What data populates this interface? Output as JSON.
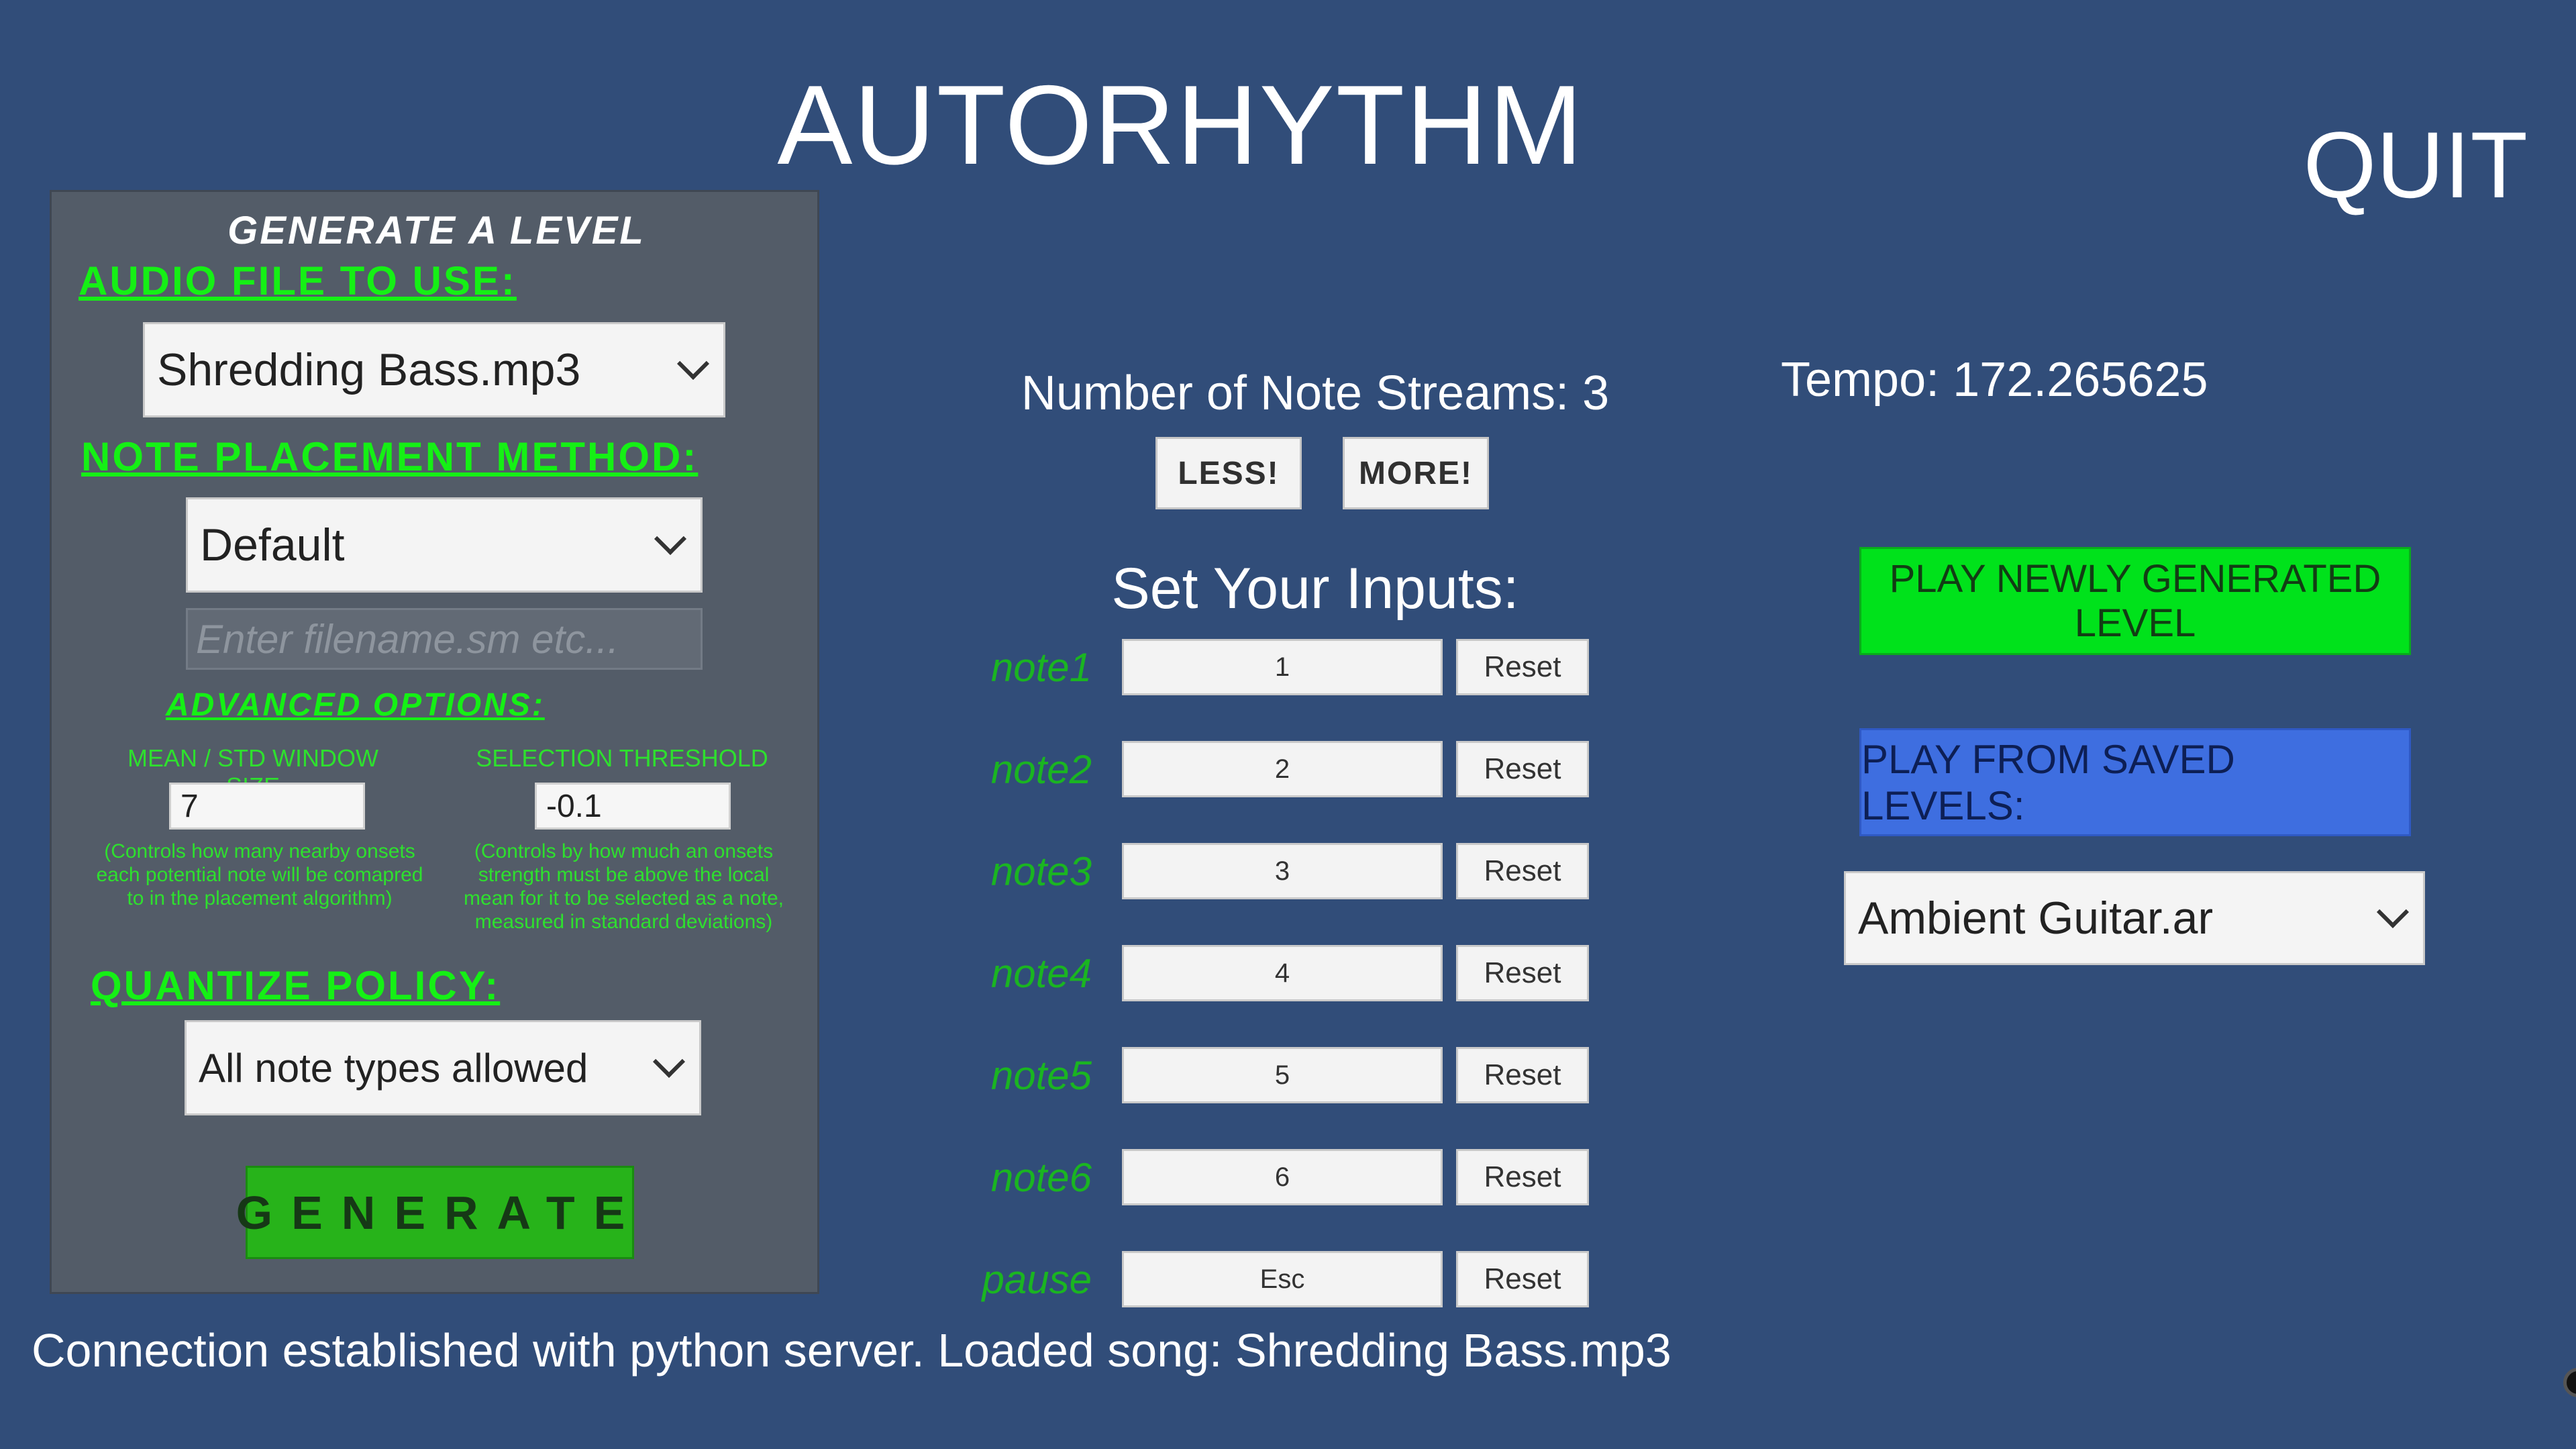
{
  "app": {
    "title": "AUTORHYTHM",
    "quit_label": "QUIT"
  },
  "generate_panel": {
    "title": "GENERATE A LEVEL",
    "audio_heading": "AUDIO FILE TO USE:",
    "audio_selected": "Shredding Bass.mp3",
    "placement_heading": "NOTE PLACEMENT METHOD:",
    "placement_selected": "Default",
    "filename_placeholder": "Enter filename.sm etc...",
    "advanced_heading": "ADVANCED OPTIONS:",
    "window_label": "MEAN / STD WINDOW SIZE",
    "window_value": "7",
    "window_help": "(Controls how many nearby onsets each potential note will be comapred to in the placement algorithm)",
    "threshold_label": "SELECTION THRESHOLD",
    "threshold_value": "-0.1",
    "threshold_help": "(Controls by how much an onsets strength must be above the local mean for it to be selected as a note, measured in standard deviations)",
    "quantize_heading": "QUANTIZE POLICY:",
    "quantize_selected": "All note types allowed",
    "generate_label": "GENERATE"
  },
  "streams": {
    "label": "Number of Note Streams: 3",
    "less_label": "LESS!",
    "more_label": "MORE!"
  },
  "inputs": {
    "heading": "Set Your Inputs:",
    "reset_label": "Reset",
    "rows": [
      {
        "name": "note1",
        "key": "1"
      },
      {
        "name": "note2",
        "key": "2"
      },
      {
        "name": "note3",
        "key": "3"
      },
      {
        "name": "note4",
        "key": "4"
      },
      {
        "name": "note5",
        "key": "5"
      },
      {
        "name": "note6",
        "key": "6"
      },
      {
        "name": "pause",
        "key": "Esc"
      }
    ]
  },
  "right": {
    "tempo": "Tempo: 172.265625",
    "play_new_label": "PLAY NEWLY GENERATED LEVEL",
    "play_saved_label": "PLAY FROM SAVED LEVELS:",
    "saved_selected": "Ambient Guitar.ar"
  },
  "status_text": "Connection established with python server. Loaded song: Shredding Bass.mp3",
  "colors": {
    "background": "#314d79",
    "panel": "#535c68",
    "green_heading": "#15f015",
    "play_new": "#00e21b",
    "play_saved": "#3e6ee0",
    "generate": "#27b31a"
  }
}
